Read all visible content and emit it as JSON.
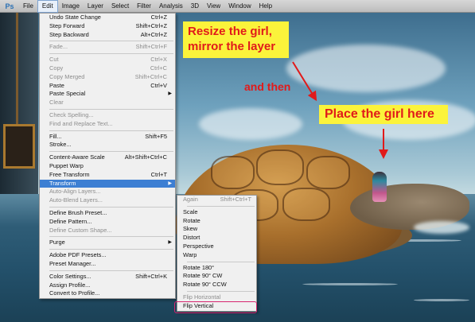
{
  "app": {
    "logo": "Ps"
  },
  "menubar": {
    "items": [
      "File",
      "Edit",
      "Image",
      "Layer",
      "Select",
      "Filter",
      "Analysis",
      "3D",
      "View",
      "Window",
      "Help"
    ],
    "active": "Edit"
  },
  "edit_menu": [
    {
      "label": "Undo State Change",
      "shortcut": "Ctrl+Z"
    },
    {
      "label": "Step Forward",
      "shortcut": "Shift+Ctrl+Z"
    },
    {
      "label": "Step Backward",
      "shortcut": "Alt+Ctrl+Z"
    },
    {
      "label": "Fade...",
      "shortcut": "Shift+Ctrl+F",
      "disabled": true
    },
    {
      "label": "Cut",
      "shortcut": "Ctrl+X",
      "disabled": true
    },
    {
      "label": "Copy",
      "shortcut": "Ctrl+C",
      "disabled": true
    },
    {
      "label": "Copy Merged",
      "shortcut": "Shift+Ctrl+C",
      "disabled": true
    },
    {
      "label": "Paste",
      "shortcut": "Ctrl+V"
    },
    {
      "label": "Paste Special",
      "shortcut": "",
      "submenu": true
    },
    {
      "label": "Clear",
      "shortcut": "",
      "disabled": true
    },
    {
      "label": "Check Spelling...",
      "shortcut": "",
      "disabled": true
    },
    {
      "label": "Find and Replace Text...",
      "shortcut": "",
      "disabled": true
    },
    {
      "label": "Fill...",
      "shortcut": "Shift+F5"
    },
    {
      "label": "Stroke...",
      "shortcut": ""
    },
    {
      "label": "Content-Aware Scale",
      "shortcut": "Alt+Shift+Ctrl+C"
    },
    {
      "label": "Puppet Warp",
      "shortcut": ""
    },
    {
      "label": "Free Transform",
      "shortcut": "Ctrl+T"
    },
    {
      "label": "Transform",
      "shortcut": "",
      "submenu": true,
      "highlighted": true
    },
    {
      "label": "Auto-Align Layers...",
      "shortcut": "",
      "disabled": true
    },
    {
      "label": "Auto-Blend Layers...",
      "shortcut": "",
      "disabled": true
    },
    {
      "label": "Define Brush Preset...",
      "shortcut": ""
    },
    {
      "label": "Define Pattern...",
      "shortcut": ""
    },
    {
      "label": "Define Custom Shape...",
      "shortcut": "",
      "disabled": true
    },
    {
      "label": "Purge",
      "shortcut": "",
      "submenu": true
    },
    {
      "label": "Adobe PDF Presets...",
      "shortcut": ""
    },
    {
      "label": "Preset Manager...",
      "shortcut": ""
    },
    {
      "label": "Color Settings...",
      "shortcut": "Shift+Ctrl+K"
    },
    {
      "label": "Assign Profile...",
      "shortcut": ""
    },
    {
      "label": "Convert to Profile...",
      "shortcut": ""
    }
  ],
  "transform_menu": [
    {
      "label": "Again",
      "shortcut": "Shift+Ctrl+T",
      "disabled": true
    },
    {
      "label": "Scale",
      "shortcut": ""
    },
    {
      "label": "Rotate",
      "shortcut": ""
    },
    {
      "label": "Skew",
      "shortcut": ""
    },
    {
      "label": "Distort",
      "shortcut": ""
    },
    {
      "label": "Perspective",
      "shortcut": ""
    },
    {
      "label": "Warp",
      "shortcut": ""
    },
    {
      "label": "Rotate 180°",
      "shortcut": ""
    },
    {
      "label": "Rotate 90° CW",
      "shortcut": ""
    },
    {
      "label": "Rotate 90° CCW",
      "shortcut": ""
    },
    {
      "label": "Flip Horizontal",
      "shortcut": "",
      "disabled": true,
      "circled": true
    },
    {
      "label": "Flip Vertical",
      "shortcut": ""
    }
  ],
  "annotations": {
    "resize": "Resize the girl, mirror the layer",
    "then": "and then",
    "place": "Place the girl here"
  },
  "colors": {
    "highlight": "#3d7fd3",
    "annotation_bg": "#fbf33b",
    "annotation_text": "#e11a1a",
    "circle": "#d7256f"
  }
}
